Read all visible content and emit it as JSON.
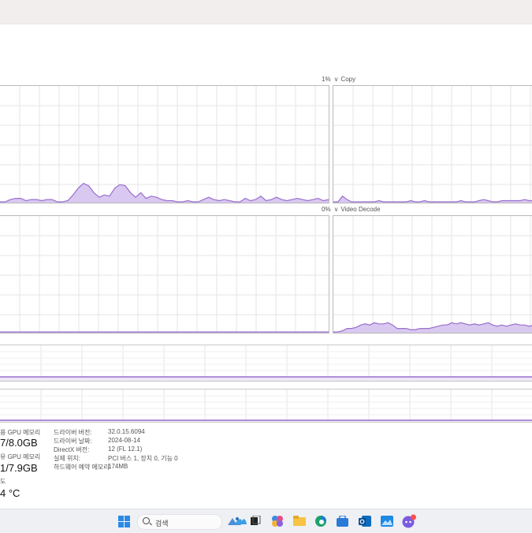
{
  "graphs": {
    "copy": {
      "percent": "1%",
      "chevron": "∨",
      "name": "Copy"
    },
    "video_decode": {
      "percent": "0%",
      "chevron": "∨",
      "name": "Video Decode"
    }
  },
  "details": {
    "dedicated_mem_label": "용 GPU 메모리",
    "dedicated_mem_value": "7/8.0GB",
    "shared_mem_label": "유 GPU 메모리",
    "shared_mem_value": "1/7.9GB",
    "temp_label": "도",
    "temp_value": "4 °C",
    "driver_version_label": "드라이버 버전:",
    "driver_version_value": "32.0.15.6094",
    "driver_date_label": "드라이버 날짜:",
    "driver_date_value": "2024-08-14",
    "directx_label": "DirectX 버전:",
    "directx_value": "12 (FL 12.1)",
    "location_label": "실제 위치:",
    "location_value": "PCI 버스 1, 장치 0, 기능 0",
    "reserved_label": "하드웨어 예약 메모리:",
    "reserved_value": "174MB"
  },
  "taskbar": {
    "search_label": "검색",
    "icons": [
      "windows-start-icon",
      "search-icon",
      "widgets-icon",
      "task-view-icon",
      "copilot-icon",
      "file-explorer-icon",
      "edge-icon",
      "store-icon",
      "outlook-icon",
      "photos-icon",
      "discord-icon"
    ]
  },
  "colors": {
    "graph_line": "#9a6fce",
    "graph_fill": "#d9c8ef",
    "grid": "#e6e6e6"
  },
  "chart_data": [
    {
      "type": "area",
      "series": [
        {
          "values": [
            0,
            0,
            2,
            3,
            3,
            1,
            2,
            2,
            1,
            2,
            2,
            0,
            0,
            1,
            6,
            12,
            16,
            14,
            8,
            4,
            6,
            5,
            12,
            15,
            14,
            8,
            4,
            8,
            3,
            5,
            4,
            2,
            1,
            1,
            0,
            0,
            1,
            0,
            0,
            2,
            4,
            2,
            1,
            2,
            1,
            0,
            0,
            3,
            1,
            2,
            5,
            1,
            2,
            4,
            2,
            1,
            2,
            3,
            2,
            1,
            2,
            3,
            1,
            2
          ]
        }
      ],
      "ylim": [
        0,
        100
      ]
    },
    {
      "type": "area",
      "series": [
        {
          "values": [
            0,
            0,
            5,
            2,
            0,
            0,
            0,
            0,
            0,
            0,
            1,
            0,
            0,
            0,
            0,
            0,
            0,
            1,
            0,
            0,
            1,
            0,
            0,
            0,
            0,
            0,
            0,
            0,
            1,
            0,
            0,
            0,
            1,
            2,
            1,
            0,
            0,
            1,
            1,
            1,
            1,
            1,
            2,
            1,
            1,
            1
          ]
        }
      ],
      "ylim": [
        0,
        100
      ]
    },
    {
      "type": "area",
      "series": [
        {
          "values": [
            0,
            0,
            0,
            0,
            0,
            0,
            0,
            0,
            0,
            0,
            0,
            0,
            0,
            0,
            0,
            0,
            0,
            0,
            0,
            0,
            0,
            0,
            0,
            0,
            0,
            0,
            0,
            0,
            0,
            0,
            0,
            0,
            0,
            0,
            0,
            0,
            0,
            0,
            0,
            0,
            0,
            0,
            0,
            0,
            0,
            0,
            0,
            0,
            0,
            0,
            0,
            0,
            0,
            0,
            0,
            0,
            0,
            0,
            0,
            0,
            0,
            0,
            0,
            0
          ]
        }
      ],
      "ylim": [
        0,
        100
      ]
    },
    {
      "type": "area",
      "series": [
        {
          "values": [
            0,
            0,
            1,
            3,
            3,
            4,
            6,
            7,
            6,
            8,
            7,
            7,
            8,
            6,
            3,
            3,
            3,
            2,
            2,
            3,
            3,
            3,
            4,
            5,
            6,
            6,
            8,
            7,
            8,
            7,
            6,
            7,
            6,
            7,
            8,
            6,
            5,
            6,
            5,
            6,
            7,
            6,
            6,
            5,
            6,
            5
          ]
        }
      ],
      "ylim": [
        0,
        100
      ]
    }
  ]
}
